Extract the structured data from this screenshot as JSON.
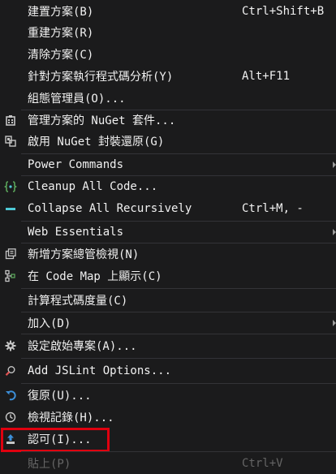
{
  "colors": {
    "background": "#1b1b1c",
    "text": "#f1f1f1",
    "disabled_text": "#656565",
    "separator": "#333337",
    "highlight_border": "#e0000f",
    "icon_blue": "#3c8fd9",
    "icon_cyan": "#4ec9d6",
    "icon_gray": "#c5c5c5",
    "icon_green": "#5aa55a"
  },
  "menu": {
    "build_solution": {
      "label": "建置方案(B)",
      "shortcut": "Ctrl+Shift+B"
    },
    "rebuild_solution": {
      "label": "重建方案(R)"
    },
    "clean_solution": {
      "label": "清除方案(C)"
    },
    "run_code_analysis": {
      "label": "針對方案執行程式碼分析(Y)",
      "shortcut": "Alt+F11"
    },
    "configuration_manager": {
      "label": "組態管理員(O)..."
    },
    "manage_nuget": {
      "label": "管理方案的 NuGet 套件...",
      "icon": "nuget-icon"
    },
    "restore_nuget": {
      "label": "啟用 NuGet 封裝還原(G)",
      "icon": "package-restore-icon"
    },
    "power_commands": {
      "label": "Power Commands"
    },
    "cleanup_all_code": {
      "label": "Cleanup All Code...",
      "icon": "cleanup-braces-icon"
    },
    "collapse_all": {
      "label": "Collapse All Recursively",
      "shortcut": "Ctrl+M, -",
      "icon": "collapse-minus-icon"
    },
    "web_essentials": {
      "label": "Web Essentials"
    },
    "new_solution_explorer_view": {
      "label": "新增方案總管檢視(N)",
      "icon": "new-view-icon"
    },
    "show_on_code_map": {
      "label": "在 Code Map 上顯示(C)",
      "icon": "code-map-icon"
    },
    "calculate_code_metrics": {
      "label": "計算程式碼度量(C)"
    },
    "add": {
      "label": "加入(D)"
    },
    "set_startup_projects": {
      "label": "設定啟始專案(A)...",
      "icon": "gear-icon"
    },
    "add_jslint": {
      "label": "Add JSLint Options...",
      "icon": "jslint-search-icon"
    },
    "undo": {
      "label": "復原(U)...",
      "icon": "undo-icon"
    },
    "view_history": {
      "label": "檢視記錄(H)...",
      "icon": "history-icon"
    },
    "approve": {
      "label": "認可(I)...",
      "icon": "commit-upload-icon"
    },
    "paste": {
      "label": "貼上(P)",
      "shortcut": "Ctrl+V"
    }
  }
}
